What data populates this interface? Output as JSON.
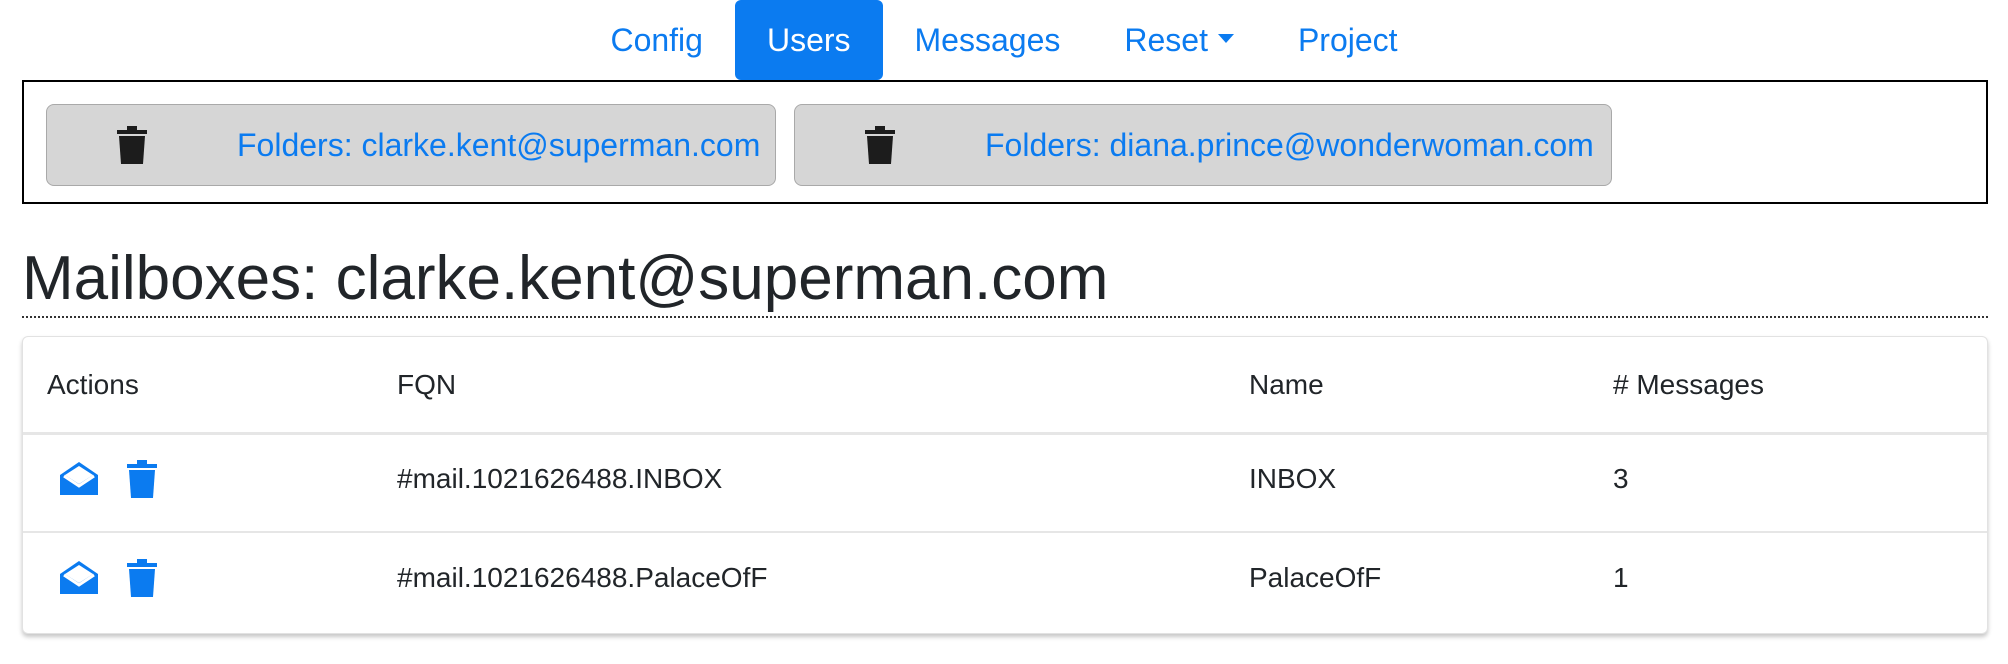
{
  "nav": {
    "items": [
      {
        "label": "Config",
        "active": false
      },
      {
        "label": "Users",
        "active": true
      },
      {
        "label": "Messages",
        "active": false
      },
      {
        "label": "Reset",
        "active": false,
        "dropdown": true
      },
      {
        "label": "Project",
        "active": false
      }
    ]
  },
  "folders": [
    {
      "label": "Folders: clarke.kent@superman.com",
      "icon": "trash-icon"
    },
    {
      "label": "Folders: diana.prince@wonderwoman.com",
      "icon": "trash-icon"
    }
  ],
  "page_title": "Mailboxes: clarke.kent@superman.com",
  "table": {
    "columns": [
      "Actions",
      "FQN",
      "Name",
      "# Messages"
    ],
    "rows": [
      {
        "actions": [
          "open-mail-icon",
          "trash-icon"
        ],
        "fqn": "#mail.1021626488.INBOX",
        "name": "INBOX",
        "messages": "3"
      },
      {
        "actions": [
          "open-mail-icon",
          "trash-icon"
        ],
        "fqn": "#mail.1021626488.PalaceOfF",
        "name": "PalaceOfF",
        "messages": "1"
      }
    ]
  },
  "colors": {
    "accent": "#0b7bf0",
    "text": "#212529",
    "folder_button_bg": "#d6d6d6"
  }
}
